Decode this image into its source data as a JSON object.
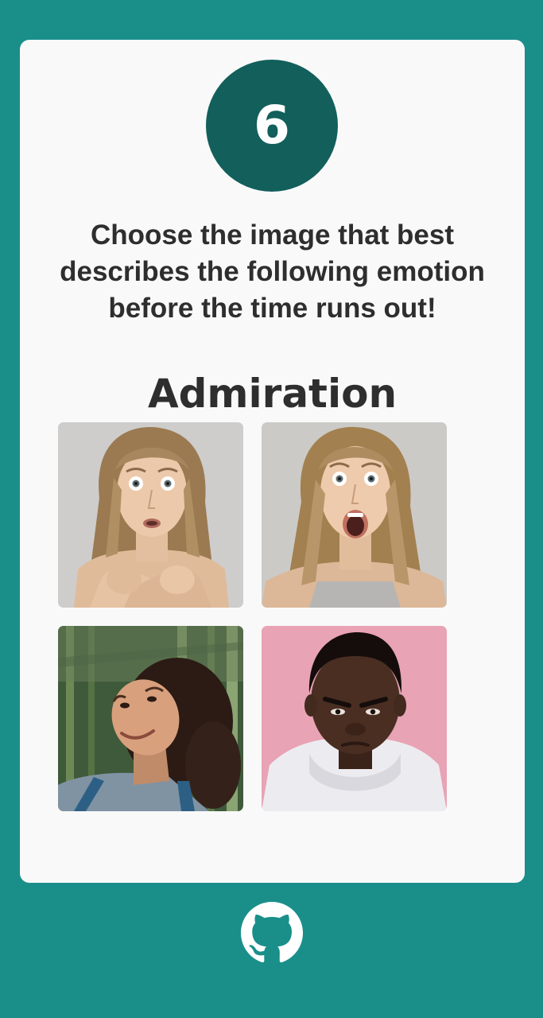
{
  "question": {
    "number": "6",
    "instructions": "Choose the image that best describes the following emotion before the time runs out!",
    "emotion": "Admiration"
  },
  "choices": [
    {
      "icon": "face-fear-photo"
    },
    {
      "icon": "face-surprise-photo"
    },
    {
      "icon": "face-admiration-photo"
    },
    {
      "icon": "face-anger-photo"
    }
  ],
  "footer": {
    "icon": "github-icon"
  },
  "colors": {
    "background": "#1a8f8a",
    "card": "#f9f9f9",
    "timer": "#125f5b",
    "text": "#2e2e2e"
  }
}
